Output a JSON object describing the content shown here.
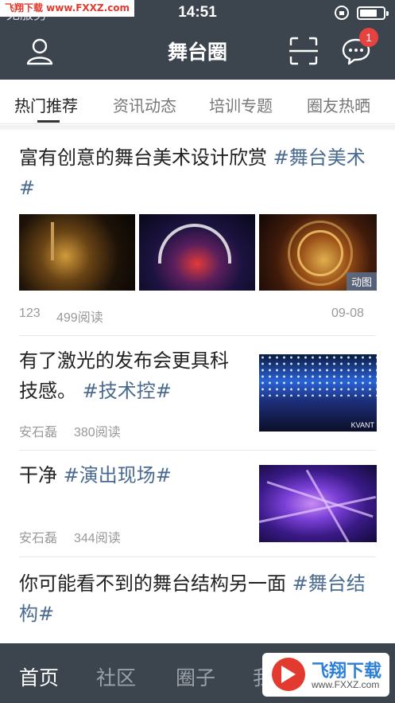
{
  "watermark_top": "飞翔下载 www.FXXZ.com",
  "status_bar": {
    "carrier": "无服务",
    "time": "14:51"
  },
  "nav": {
    "title": "舞台圈",
    "message_badge": "1"
  },
  "tabs": [
    {
      "label": "热门推荐",
      "active": true
    },
    {
      "label": "资讯动态",
      "active": false
    },
    {
      "label": "培训专题",
      "active": false
    },
    {
      "label": "圈友热晒",
      "active": false
    }
  ],
  "feed": [
    {
      "title": "富有创意的舞台美术设计欣赏 ",
      "tag": "#舞台美术#",
      "count": "123",
      "reads": "499阅读",
      "date": "09-08",
      "anim_label": "动图"
    },
    {
      "title": "有了激光的发布会更具科技感。 ",
      "tag": "#技术控#",
      "author": "安石磊",
      "reads": "380阅读",
      "image_text": "KVANT"
    },
    {
      "title": "干净 ",
      "tag": "#演出现场#",
      "author": "安石磊",
      "reads": "344阅读"
    },
    {
      "title": "你可能看不到的舞台结构另一面 ",
      "tag": "#舞台结构#"
    }
  ],
  "bottom_tabs": [
    {
      "label": "首页",
      "active": true
    },
    {
      "label": "社区",
      "active": false
    },
    {
      "label": "圈子",
      "active": false
    },
    {
      "label": "我",
      "active": false
    }
  ],
  "watermark_bottom": {
    "name": "飞翔下载",
    "url": "www.FXXZ.com"
  },
  "colors": {
    "bar_bg": "#3c444d",
    "tag": "#4a6a8f",
    "badge": "#e64340"
  }
}
